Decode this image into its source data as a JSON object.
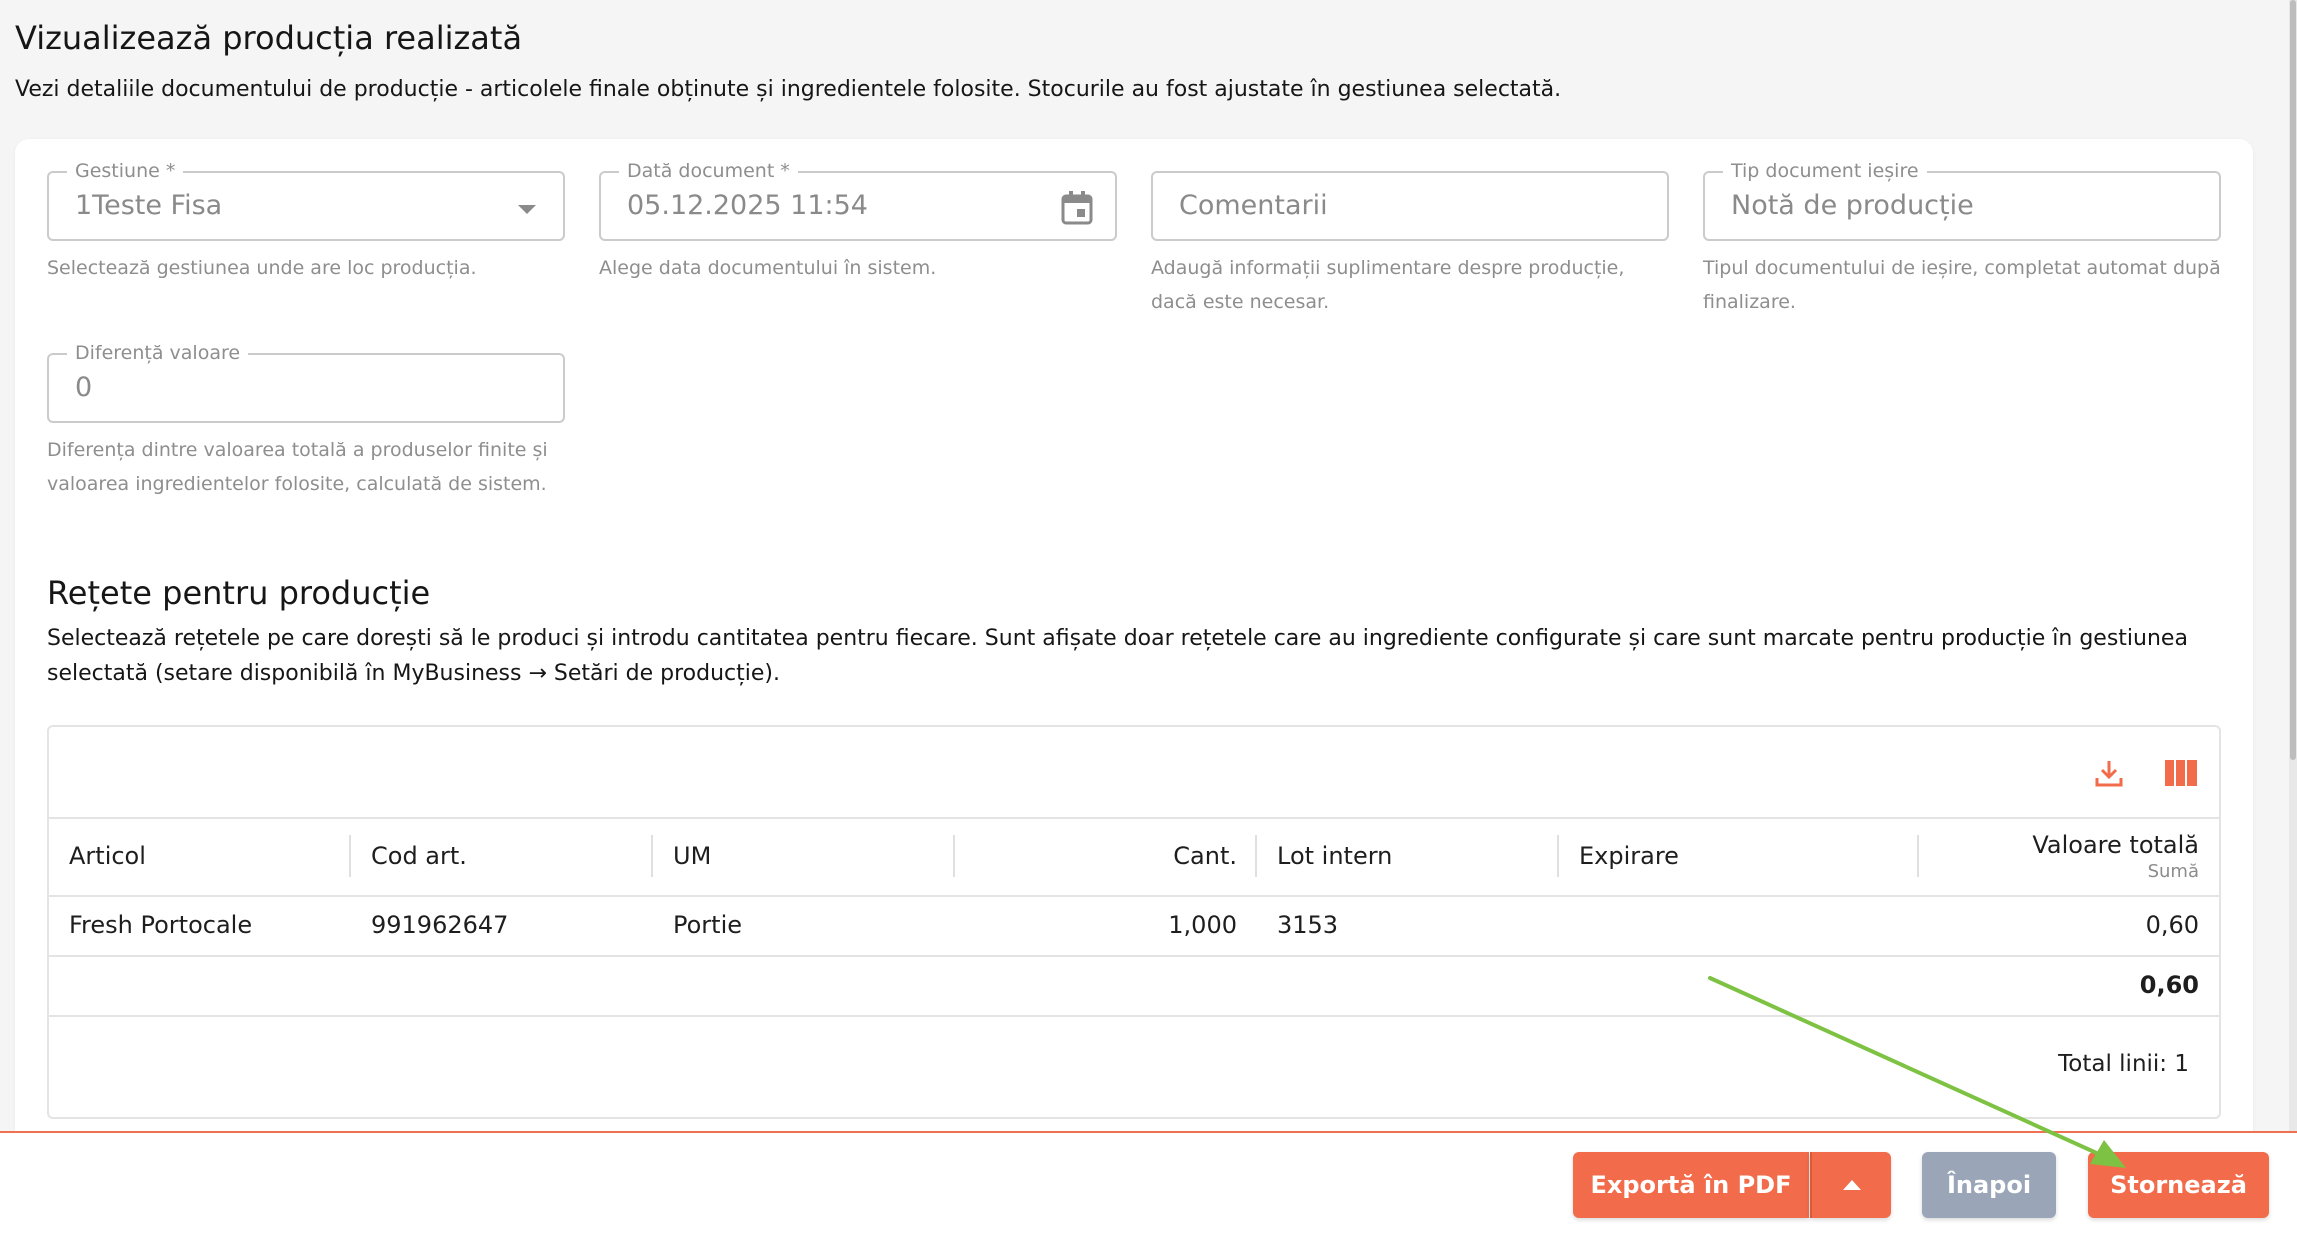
{
  "header": {
    "title": "Vizualizează producția realizată",
    "subtitle": "Vezi detaliile documentului de producție - articolele finale obținute și ingredientele folosite. Stocurile au fost ajustate în gestiunea selectată."
  },
  "form": {
    "gestiune": {
      "label": "Gestiune *",
      "value": "1Teste Fisa",
      "helper": "Selectează gestiunea unde are loc producția."
    },
    "data_document": {
      "label": "Dată document *",
      "value": "05.12.2025 11:54",
      "helper": "Alege data documentului în sistem."
    },
    "comentarii": {
      "placeholder": "Comentarii",
      "helper": "Adaugă informații suplimentare despre producție, dacă este necesar."
    },
    "tip_document": {
      "label": "Tip document ieșire",
      "value": "Notă de producție",
      "helper": "Tipul documentului de ieșire, completat automat după finalizare."
    },
    "diferenta_valoare": {
      "label": "Diferență valoare",
      "value": "0",
      "helper": "Diferența dintre valoarea totală a produselor finite și valoarea ingredientelor folosite, calculată de sistem."
    }
  },
  "section": {
    "title": "Rețete pentru producție",
    "description": "Selectează rețetele pe care dorești să le produci și introdu cantitatea pentru fiecare. Sunt afișate doar rețetele care au ingrediente configurate și care sunt marcate pentru producție în gestiunea selectată (setare disponibilă în MyBusiness → Setări de producție)."
  },
  "grid": {
    "columns": {
      "articol": "Articol",
      "cod": "Cod art.",
      "um": "UM",
      "cant": "Cant.",
      "lot": "Lot intern",
      "expirare": "Expirare",
      "valoare": "Valoare totală",
      "valoare_sub": "Sumă"
    },
    "rows": [
      {
        "articol": "Fresh Portocale",
        "cod": "991962647",
        "um": "Portie",
        "cant": "1,000",
        "lot": "3153",
        "expirare": "",
        "valoare": "0,60"
      }
    ],
    "total_valoare": "0,60",
    "total_lines": "Total linii: 1"
  },
  "actions": {
    "export_pdf": "Exportă în PDF",
    "back": "Înapoi",
    "storno": "Stornează"
  },
  "colors": {
    "accent": "#f26b4a",
    "secondary": "#9aa6b8",
    "annotation": "#7dc242"
  }
}
